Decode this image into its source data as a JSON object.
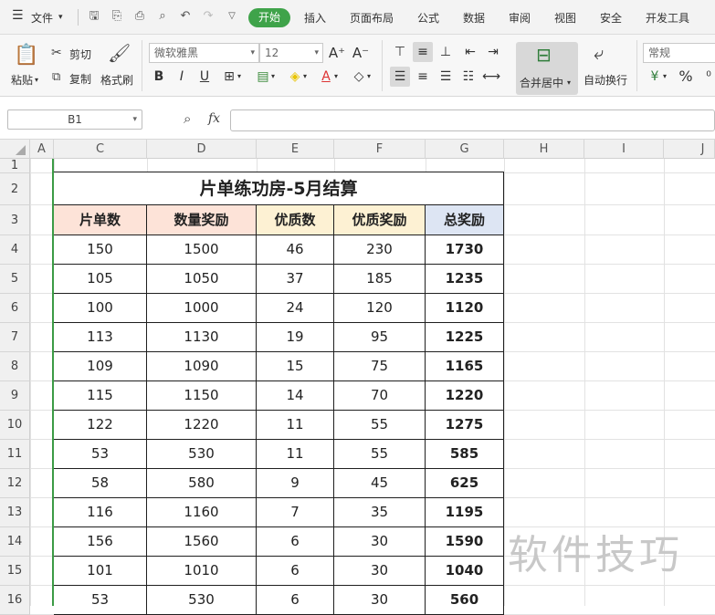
{
  "menubar": {
    "file_label": "文件",
    "tabs": [
      {
        "label": "开始",
        "active": true
      },
      {
        "label": "插入"
      },
      {
        "label": "页面布局"
      },
      {
        "label": "公式"
      },
      {
        "label": "数据"
      },
      {
        "label": "审阅"
      },
      {
        "label": "视图"
      },
      {
        "label": "安全"
      },
      {
        "label": "开发工具"
      }
    ],
    "active_color": "#3fa34a"
  },
  "ribbon": {
    "paste_label": "粘贴",
    "cut_label": "剪切",
    "copy_label": "复制",
    "format_painter_label": "格式刷",
    "font_name": "微软雅黑",
    "font_size": "12",
    "merge_label": "合并居中",
    "wrap_label": "自动换行",
    "number_format": "常规"
  },
  "formula_bar": {
    "name_box": "B1",
    "fx_label": "fx",
    "value": ""
  },
  "columns": [
    "A",
    "C",
    "D",
    "E",
    "F",
    "G",
    "H",
    "I",
    "J"
  ],
  "rows": [
    "1",
    "2",
    "3",
    "4",
    "5",
    "6",
    "7",
    "8",
    "9",
    "10",
    "11",
    "12",
    "13",
    "14",
    "15",
    "16"
  ],
  "table": {
    "title": "片单练功房-5月结算",
    "headers": [
      "片单数",
      "数量奖励",
      "优质数",
      "优质奖励",
      "总奖励"
    ],
    "header_colors": [
      "#fde3d8",
      "#fde3d8",
      "#fdf1d3",
      "#fdf1d3",
      "#dde5f3"
    ],
    "rows": [
      [
        "150",
        "1500",
        "46",
        "230",
        "1730"
      ],
      [
        "105",
        "1050",
        "37",
        "185",
        "1235"
      ],
      [
        "100",
        "1000",
        "24",
        "120",
        "1120"
      ],
      [
        "113",
        "1130",
        "19",
        "95",
        "1225"
      ],
      [
        "109",
        "1090",
        "15",
        "75",
        "1165"
      ],
      [
        "115",
        "1150",
        "14",
        "70",
        "1220"
      ],
      [
        "122",
        "1220",
        "11",
        "55",
        "1275"
      ],
      [
        "53",
        "530",
        "11",
        "55",
        "585"
      ],
      [
        "58",
        "580",
        "9",
        "45",
        "625"
      ],
      [
        "116",
        "1160",
        "7",
        "35",
        "1195"
      ],
      [
        "156",
        "1560",
        "6",
        "30",
        "1590"
      ],
      [
        "101",
        "1010",
        "6",
        "30",
        "1040"
      ],
      [
        "53",
        "530",
        "6",
        "30",
        "560"
      ]
    ]
  },
  "watermark": "软件技巧"
}
